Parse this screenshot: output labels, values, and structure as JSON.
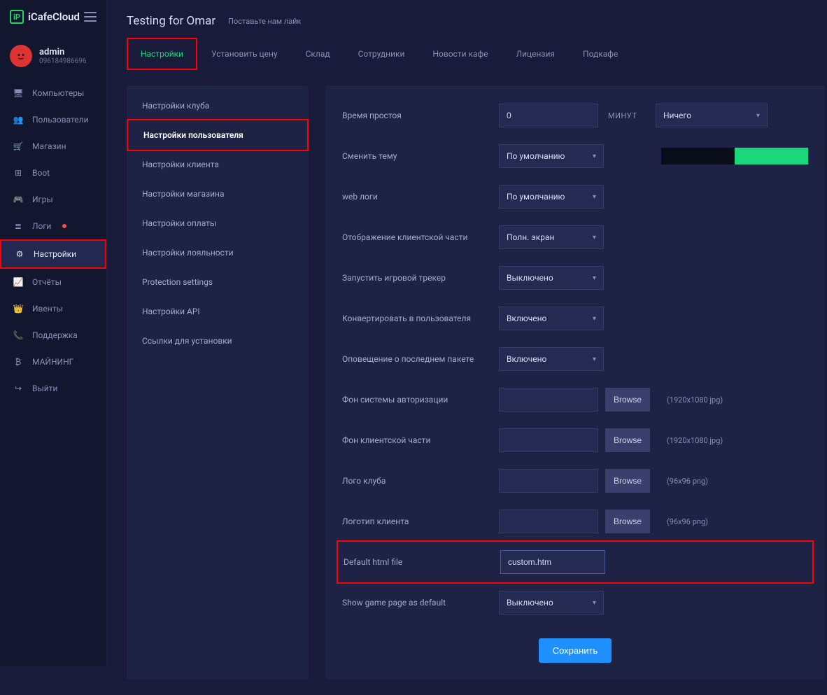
{
  "brand": "iCafeCloud",
  "header": {
    "title": "Testing for Omar",
    "like": "Поставьте нам лайк"
  },
  "user": {
    "name": "admin",
    "id": "096184986696"
  },
  "sidebar": {
    "items": [
      {
        "label": "Компьютеры",
        "icon": "monitor"
      },
      {
        "label": "Пользователи",
        "icon": "users"
      },
      {
        "label": "Магазин",
        "icon": "cart"
      },
      {
        "label": "Boot",
        "icon": "windows"
      },
      {
        "label": "Игры",
        "icon": "gamepad"
      },
      {
        "label": "Логи",
        "icon": "logs",
        "dot": true
      },
      {
        "label": "Настройки",
        "icon": "gear",
        "active": true
      },
      {
        "label": "Отчёты",
        "icon": "chart"
      },
      {
        "label": "Ивенты",
        "icon": "crown"
      },
      {
        "label": "Поддержка",
        "icon": "phone"
      },
      {
        "label": "МАЙНИНГ",
        "icon": "bitcoin"
      },
      {
        "label": "Выйти",
        "icon": "logout"
      }
    ]
  },
  "tabs": [
    {
      "label": "Настройки",
      "active": true
    },
    {
      "label": "Установить цену"
    },
    {
      "label": "Склад"
    },
    {
      "label": "Сотрудники"
    },
    {
      "label": "Новости кафе"
    },
    {
      "label": "Лицензия"
    },
    {
      "label": "Подкафе"
    }
  ],
  "subnav": [
    {
      "label": "Настройки клуба"
    },
    {
      "label": "Настройки пользователя",
      "active": true
    },
    {
      "label": "Настройки клиента"
    },
    {
      "label": "Настройки магазина"
    },
    {
      "label": "Настройки оплаты"
    },
    {
      "label": "Настройки лояльности"
    },
    {
      "label": "Protection settings"
    },
    {
      "label": "Настройки API"
    },
    {
      "label": "Ссылки для установки"
    }
  ],
  "form": {
    "idle_label": "Время простоя",
    "idle_value": "0",
    "idle_unit": "МИНУТ",
    "idle_action": "Ничего",
    "theme_label": "Сменить тему",
    "theme_value": "По умолчанию",
    "weblogs_label": "web логи",
    "weblogs_value": "По умолчанию",
    "clientview_label": "Отображение клиентской части",
    "clientview_value": "Полн. экран",
    "tracker_label": "Запустить игровой трекер",
    "tracker_value": "Выключено",
    "convert_label": "Конвертировать в пользователя",
    "convert_value": "Включено",
    "lastpacket_label": "Оповещение о последнем пакете",
    "lastpacket_value": "Включено",
    "bg_auth_label": "Фон системы авторизации",
    "bg_client_label": "Фон клиентской части",
    "logo_club_label": "Лого клуба",
    "logo_client_label": "Логотип клиента",
    "browse": "Browse",
    "hint_1920": "(1920x1080 jpg)",
    "hint_96": "(96x96 png)",
    "html_label": "Default html file",
    "html_value": "custom.htm",
    "gamepage_label": "Show game page as default",
    "gamepage_value": "Выключено",
    "save": "Сохранить"
  }
}
